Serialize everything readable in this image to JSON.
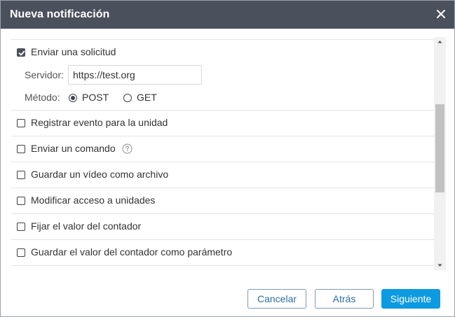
{
  "dialog": {
    "title": "Nueva notificación",
    "close_icon": "close-icon"
  },
  "actions": [
    {
      "label": "Enviar una solicitud",
      "checked": true,
      "server_label": "Servidor:",
      "server_value": "https://test.org",
      "method_label": "Método:",
      "methods": [
        {
          "label": "POST",
          "selected": true
        },
        {
          "label": "GET",
          "selected": false
        }
      ]
    },
    {
      "label": "Registrar evento para la unidad",
      "checked": false
    },
    {
      "label": "Enviar un comando",
      "checked": false,
      "help_icon": "question-circle-icon"
    },
    {
      "label": "Guardar un vídeo como archivo",
      "checked": false
    },
    {
      "label": "Modificar acceso a unidades",
      "checked": false
    },
    {
      "label": "Fijar el valor del contador",
      "checked": false
    },
    {
      "label": "Guardar el valor del contador como parámetro",
      "checked": false
    }
  ],
  "footer": {
    "cancel_label": "Cancelar",
    "back_label": "Atrás",
    "next_label": "Siguiente"
  },
  "colors": {
    "titlebar": "#4a505c",
    "primary": "#0d9ae0",
    "outline_text": "#2c6ea6"
  }
}
